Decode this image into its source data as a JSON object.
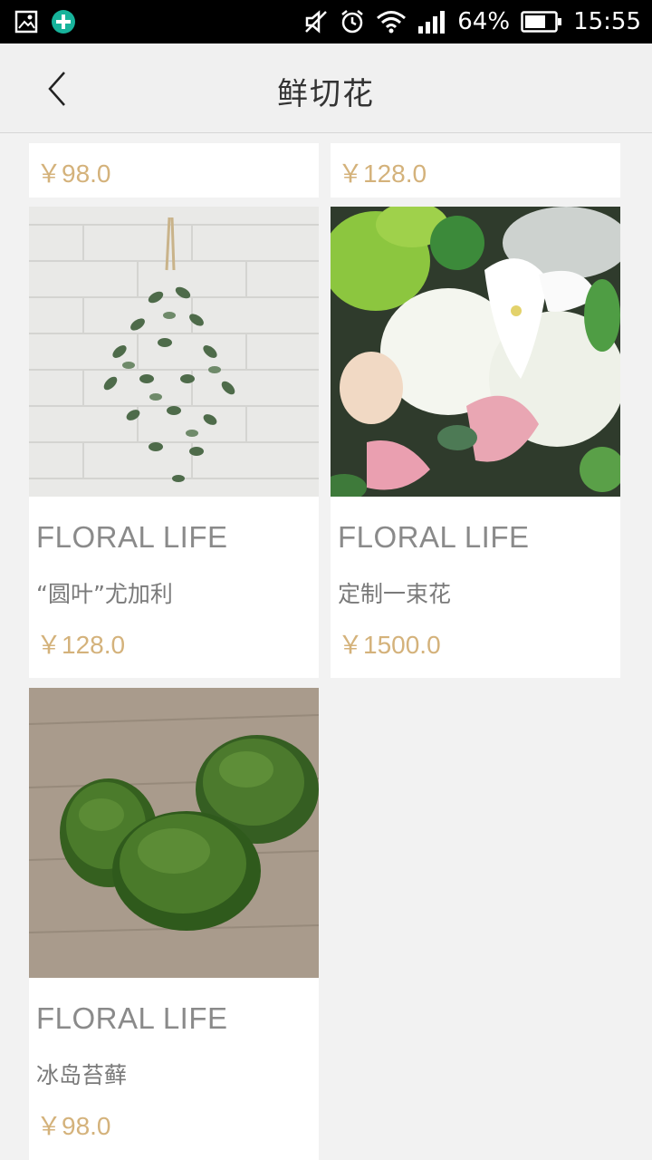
{
  "status_bar": {
    "battery": "64%",
    "time": "15:55",
    "icons": [
      "gallery-icon",
      "plus-circle-icon",
      "mute-icon",
      "alarm-icon",
      "wifi-icon",
      "signal-icon",
      "battery-icon"
    ]
  },
  "header": {
    "title": "鲜切花",
    "back_icon": "chevron-left-icon"
  },
  "products_partial": [
    {
      "price": "￥98.0"
    },
    {
      "price": "￥128.0"
    }
  ],
  "products": [
    {
      "brand": "FLORAL LIFE",
      "name": "“圆叶”尤加利",
      "price": "￥128.0",
      "image": "eucalyptus-bunch"
    },
    {
      "brand": "FLORAL LIFE",
      "name": "定制一束花",
      "price": "￥1500.0",
      "image": "mixed-bouquet"
    },
    {
      "brand": "FLORAL LIFE",
      "name": "冰岛苔藓",
      "price": "￥98.0",
      "image": "moss-balls"
    }
  ],
  "colors": {
    "price": "#d4b27b",
    "brand": "#8a8a8a",
    "background": "#f2f2f2"
  }
}
